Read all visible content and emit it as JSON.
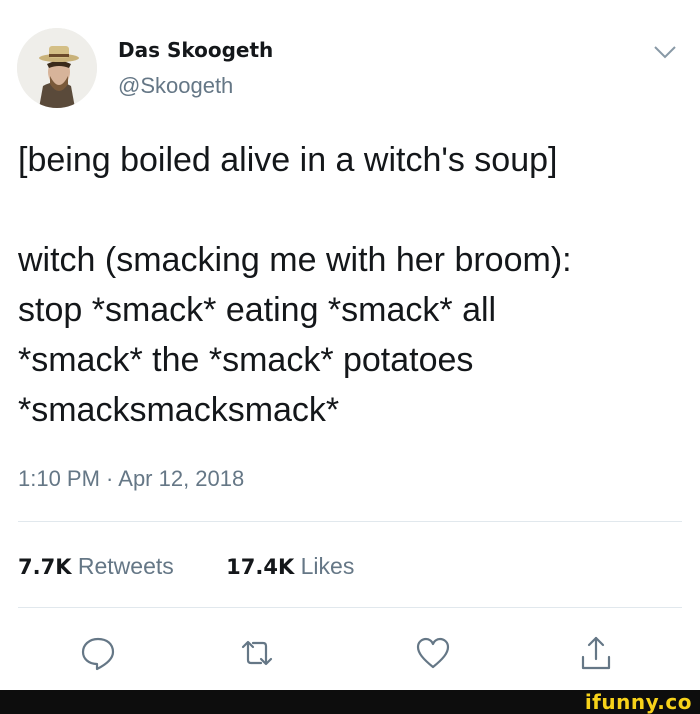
{
  "author": {
    "name": "Das Skoogeth",
    "handle": "@Skoogeth"
  },
  "tweet": {
    "line1": "[being boiled alive in a witch's soup]",
    "line2": "witch (smacking me with her broom):",
    "line3": "stop *smack* eating *smack* all",
    "line4": "*smack* the *smack* potatoes",
    "line5": "*smacksmacksmack*",
    "timestamp": "1:10 PM · Apr 12, 2018"
  },
  "stats": {
    "retweets_count": "7.7K",
    "retweets_label": "Retweets",
    "likes_count": "17.4K",
    "likes_label": "Likes"
  },
  "icons": {
    "menu": "chevron-down-icon",
    "reply": "reply-icon",
    "retweet": "retweet-icon",
    "like": "heart-icon",
    "share": "share-icon"
  },
  "watermark": "ifunny.co",
  "colors": {
    "text": "#14171a",
    "secondary": "#657786",
    "divider": "#e1e8ed",
    "watermark": "#f7d21a"
  }
}
